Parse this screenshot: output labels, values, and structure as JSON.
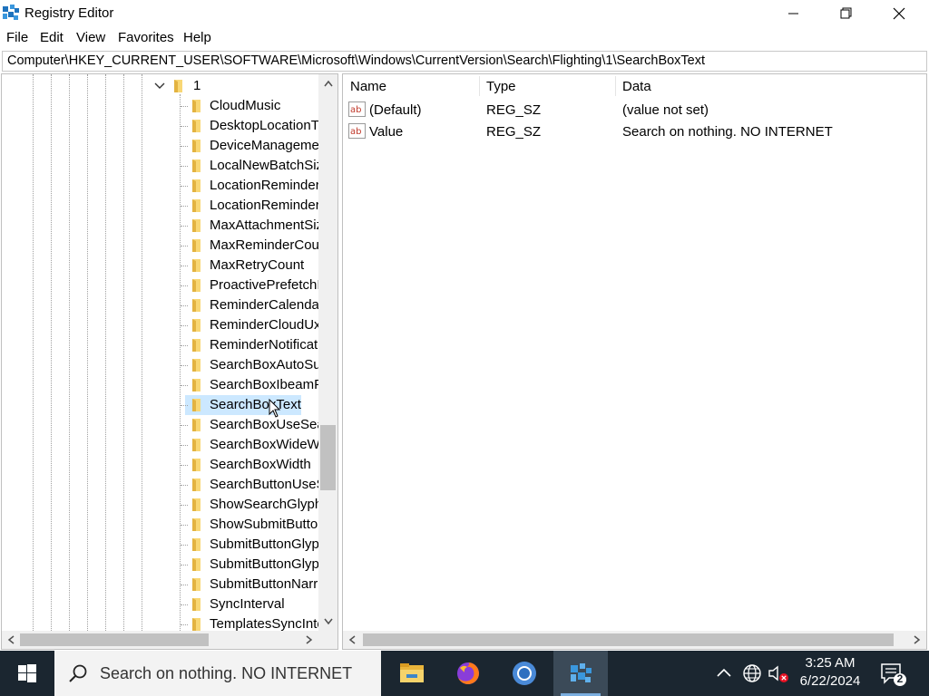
{
  "window": {
    "title": "Registry Editor",
    "address": "Computer\\HKEY_CURRENT_USER\\SOFTWARE\\Microsoft\\Windows\\CurrentVersion\\Search\\Flighting\\1\\SearchBoxText"
  },
  "menu": [
    "File",
    "Edit",
    "View",
    "Favorites",
    "Help"
  ],
  "tree": {
    "root_label": "1",
    "items": [
      "CloudMusic",
      "DesktopLocationT",
      "DeviceManageme",
      "LocalNewBatchSiz",
      "LocationReminder",
      "LocationReminder",
      "MaxAttachmentSiz",
      "MaxReminderCour",
      "MaxRetryCount",
      "ProactivePrefetchI",
      "ReminderCalendar",
      "ReminderCloudUx",
      "ReminderNotificat",
      "SearchBoxAutoSug",
      "SearchBoxIbeamPe",
      "SearchBoxText",
      "SearchBoxUseSear",
      "SearchBoxWideWi",
      "SearchBoxWidth",
      "SearchButtonUseS",
      "ShowSearchGlyphI",
      "ShowSubmitButto",
      "SubmitButtonGlyp",
      "SubmitButtonGlyp",
      "SubmitButtonNarr",
      "SyncInterval",
      "TemplatesSyncInte"
    ],
    "selected": "SearchBoxText"
  },
  "list": {
    "columns": [
      "Name",
      "Type",
      "Data"
    ],
    "rows": [
      {
        "name": "(Default)",
        "type": "REG_SZ",
        "data": "(value not set)"
      },
      {
        "name": "Value",
        "type": "REG_SZ",
        "data": "Search on nothing. NO INTERNET"
      }
    ]
  },
  "taskbar": {
    "search_text": "Search on nothing. NO INTERNET",
    "time": "3:25 AM",
    "date": "6/22/2024",
    "notification_count": "2",
    "apps": [
      "file-explorer",
      "firefox",
      "chrome",
      "registry-editor"
    ]
  }
}
